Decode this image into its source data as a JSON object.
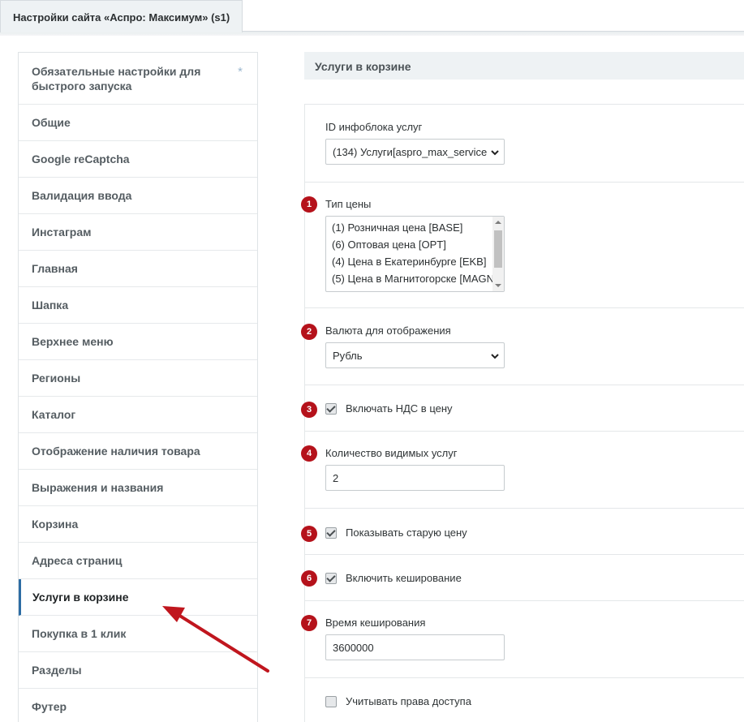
{
  "tab": {
    "title": "Настройки сайта «Аспро: Максимум» (s1)"
  },
  "sidebar": {
    "items": [
      {
        "label": "Обязательные настройки для быстрого запуска"
      },
      {
        "label": "Общие"
      },
      {
        "label": "Google reCaptcha"
      },
      {
        "label": "Валидация ввода"
      },
      {
        "label": "Инстаграм"
      },
      {
        "label": "Главная"
      },
      {
        "label": "Шапка"
      },
      {
        "label": "Верхнее меню"
      },
      {
        "label": "Регионы"
      },
      {
        "label": "Каталог"
      },
      {
        "label": "Отображение наличия товара"
      },
      {
        "label": "Выражения и названия"
      },
      {
        "label": "Корзина"
      },
      {
        "label": "Адреса страниц"
      },
      {
        "label": "Услуги в корзине"
      },
      {
        "label": "Покупка в 1 клик"
      },
      {
        "label": "Разделы"
      },
      {
        "label": "Футер"
      }
    ],
    "star": "*",
    "active": "Услуги в корзине"
  },
  "main": {
    "section_title": "Услуги в корзине",
    "iblock": {
      "label": "ID инфоблока услуг",
      "value": "(134) Услуги[aspro_max_service"
    },
    "price_type": {
      "badge": "1",
      "label": "Тип цены",
      "options": [
        "(1) Розничная цена [BASE]",
        "(6) Оптовая цена [OPT]",
        "(4) Цена в Екатеринбурге [EKB]",
        "(5) Цена в Магнитогорске [MAGN"
      ]
    },
    "currency": {
      "badge": "2",
      "label": "Валюта для отображения",
      "value": "Рубль"
    },
    "vat": {
      "badge": "3",
      "label": "Включать НДС в цену",
      "checked": true
    },
    "visible_count": {
      "badge": "4",
      "label": "Количество видимых услуг",
      "value": "2"
    },
    "old_price": {
      "badge": "5",
      "label": "Показывать старую цену",
      "checked": true
    },
    "caching": {
      "badge": "6",
      "label": "Включить кеширование",
      "checked": true
    },
    "cache_time": {
      "badge": "7",
      "label": "Время кеширования",
      "value": "3600000"
    },
    "access_rights": {
      "label": "Учитывать права доступа",
      "checked": false
    }
  },
  "colors": {
    "badge": "#b5121b",
    "arrow": "#c0161e",
    "active_border": "#2d6da4"
  },
  "icons": {
    "select_arrow": "chevron-down-icon",
    "pointer": "arrow-pointer-icon"
  }
}
